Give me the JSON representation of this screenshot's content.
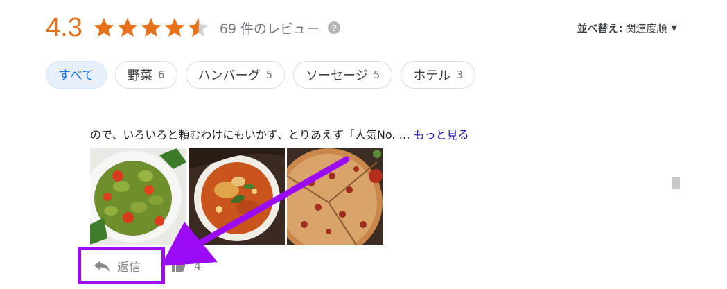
{
  "summary": {
    "score": "4.3",
    "rating_value": 4.3,
    "rating_max": 5,
    "review_count": "69 件のレビュー",
    "accent_color": "#e7711b"
  },
  "sort": {
    "label": "並べ替え:",
    "value": "関連度順"
  },
  "filters": [
    {
      "label": "すべて",
      "count": "",
      "selected": true
    },
    {
      "label": "野菜",
      "count": "6"
    },
    {
      "label": "ハンバーグ",
      "count": "5"
    },
    {
      "label": "ソーセージ",
      "count": "5"
    },
    {
      "label": "ホテル",
      "count": "3"
    }
  ],
  "review": {
    "snippet": "ので、いろいろと頼むわけにもいかず、とりあえず「人気No. … ",
    "more_link": "もっと見る",
    "photos": [
      "pasta-salad-photo",
      "curry-bowl-photo",
      "pizza-photo"
    ],
    "reply_label": "返信",
    "like_count": "4"
  },
  "annotation": {
    "highlight_color": "#9c0bf5"
  }
}
